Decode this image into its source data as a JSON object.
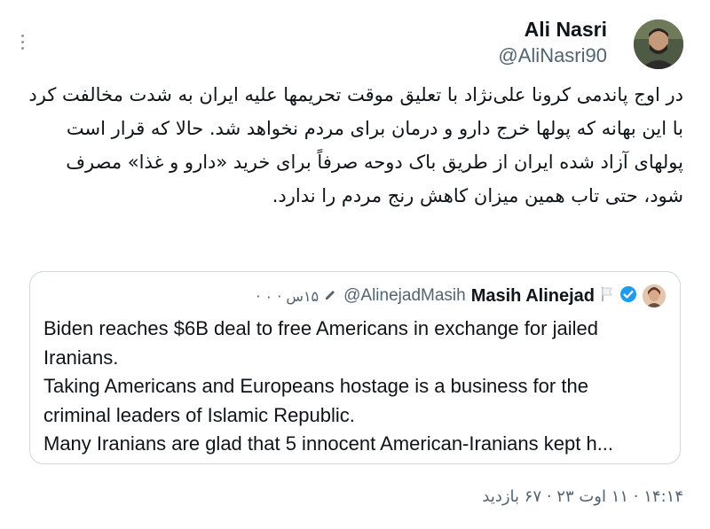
{
  "tweet": {
    "author_name": "Ali Nasri",
    "author_handle": "@AliNasri90",
    "text": "در اوج پاندمی کرونا علی‌نژاد با تعلیق موقت تحریمها علیه ایران به شدت مخالفت کرد با این بهانه که پولها خرج دارو و درمان برای مردم نخواهد شد. حالا که قرار است پولهای آزاد شده ایران از طریق باک دوحه صرفاً برای خرید «دارو و غذا» مصرف شود، حتی تاب همین میزان کاهش رنج مردم را ندارد.",
    "footer": "۱۴:۱۴ · ۱۱ اوت ۲۳ · ۶۷ بازدید",
    "more_icon": "more-vertical-icon"
  },
  "quote": {
    "name": "Masih Alinejad",
    "handle": "@AlinejadMasih",
    "meta": "۱۵س · ۰ ·",
    "verified_color": "#1d9bf0",
    "lines": [
      "Biden reaches $6B deal to free Americans in exchange for jailed",
      "Iranians.",
      "Taking Americans and Europeans hostage is a business for the",
      "criminal leaders of Islamic Republic.",
      "Many Iranians are glad that 5 innocent American-Iranians kept h..."
    ]
  }
}
